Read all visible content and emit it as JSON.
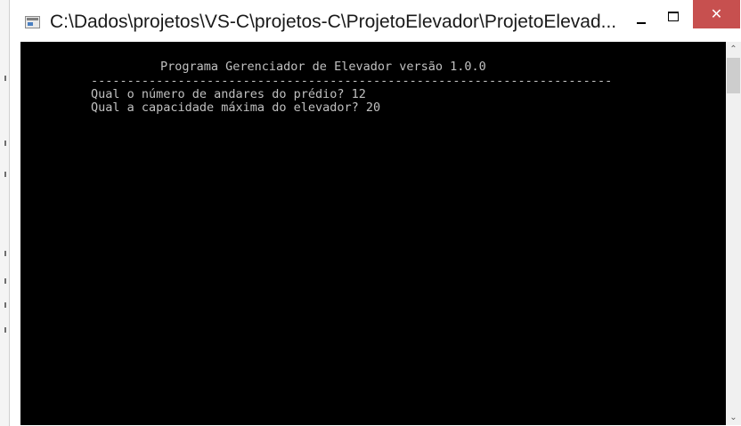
{
  "window": {
    "title": "C:\\Dados\\projetos\\VS-C\\projetos-C\\ProjetoElevador\\ProjetoElevad...",
    "close_glyph": "✕",
    "icon": "console-window-icon",
    "close_color": "#c7504f"
  },
  "console": {
    "background": "#000000",
    "text_color": "#c0c0c0",
    "lines": [
      "Programa Gerenciador de Elevador versão 1.0.0",
      "------------------------------------------------------------------------",
      "Qual o número de andares do prédio? 12",
      "Qual a capacidade máxima do elevador? 20"
    ]
  },
  "scrollbar": {
    "up_glyph": "⌃",
    "down_glyph": "⌄"
  }
}
